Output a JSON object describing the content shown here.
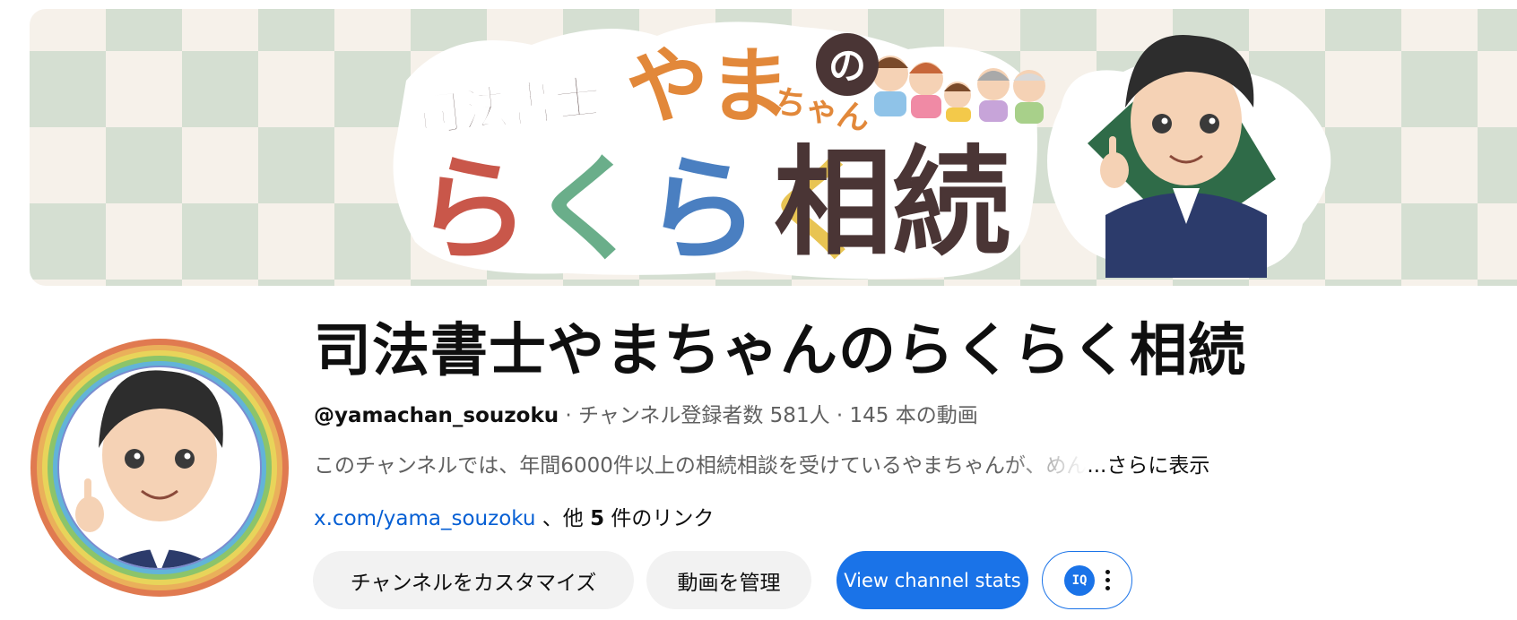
{
  "banner": {
    "title_line1": "司法書士",
    "title_yama": "やま",
    "title_no": "の",
    "title_chan": "ちゃん",
    "title_line2": "らくらく",
    "title_kanji": "相続"
  },
  "channel": {
    "name": "司法書士やまちゃんのらくらく相続",
    "handle": "@yamachan_souzoku",
    "stats": " · チャンネル登録者数 581人 · 145 本の動画",
    "description": "このチャンネルでは、年間6000件以上の相続相談を受けているやまちゃんが、めん",
    "more_label": "...さらに表示",
    "link_text": "x.com/yama_souzoku",
    "link_suffix_pre": " 、他 ",
    "link_count": "5",
    "link_suffix_post": " 件のリンク"
  },
  "buttons": {
    "customize": "チャンネルをカスタマイズ",
    "manage": "動画を管理",
    "stats": "View channel stats"
  },
  "icons": {
    "extension": "extension-icon",
    "more": "more-vert-icon"
  },
  "colors": {
    "accent_blue": "#1a73e8",
    "link_blue": "#065fd4",
    "title_orange": "#e2883a",
    "ra_red": "#c9574a",
    "ku_green": "#6aae8a",
    "ra_blue": "#4a7fc1",
    "ku_yellow": "#e8c453",
    "kanji_brown": "#4a3535"
  }
}
